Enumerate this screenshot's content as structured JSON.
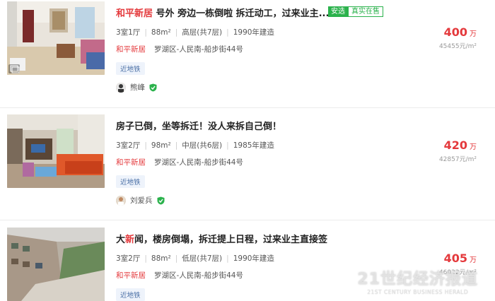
{
  "listings": [
    {
      "title_highlight": "和平新居",
      "title": "号外 旁边一栋倒啦 拆迁动工，过来业主...",
      "badge_primary": "安选",
      "badge_secondary": "真实在售",
      "layout": "3室1厅",
      "area": "88m²",
      "floor": "高层(共7层)",
      "year": "1990年建造",
      "community": "和平新居",
      "address": "罗湖区-人民南-船步街44号",
      "tag": "近地铁",
      "agent": "熊峰",
      "price": "400",
      "price_unit": "万",
      "unit_price": "45455元/m²"
    },
    {
      "title_highlight": "",
      "title": "房子已倒，坐等拆迁！没人来拆自己倒！",
      "layout": "3室2厅",
      "area": "98m²",
      "floor": "中层(共6层)",
      "year": "1985年建造",
      "community": "和平新居",
      "address": "罗湖区-人民南-船步街44号",
      "tag": "近地铁",
      "agent": "刘爱兵",
      "price": "420",
      "price_unit": "万",
      "unit_price": "42857元/m²"
    },
    {
      "title_pre": "大",
      "title_highlight": "新",
      "title": "闻，楼房倒塌，拆迁提上日程，过来业主直接签",
      "layout": "3室2厅",
      "area": "88m²",
      "floor": "低层(共7层)",
      "year": "1990年建造",
      "community": "和平新居",
      "address": "罗湖区-人民南-船步街44号",
      "tag": "近地铁",
      "price": "405",
      "price_unit": "万",
      "unit_price": "46022元/m²"
    }
  ],
  "watermark": {
    "main": "21世纪经济报道",
    "sub": "21ST CENTURY BUSINESS HERALD"
  },
  "colors": {
    "accent_red": "#e4393c",
    "badge_green": "#2bb24c",
    "tag_blue": "#4a6fa5"
  },
  "icons": [
    "gallery-icon",
    "verified-shield-icon"
  ]
}
